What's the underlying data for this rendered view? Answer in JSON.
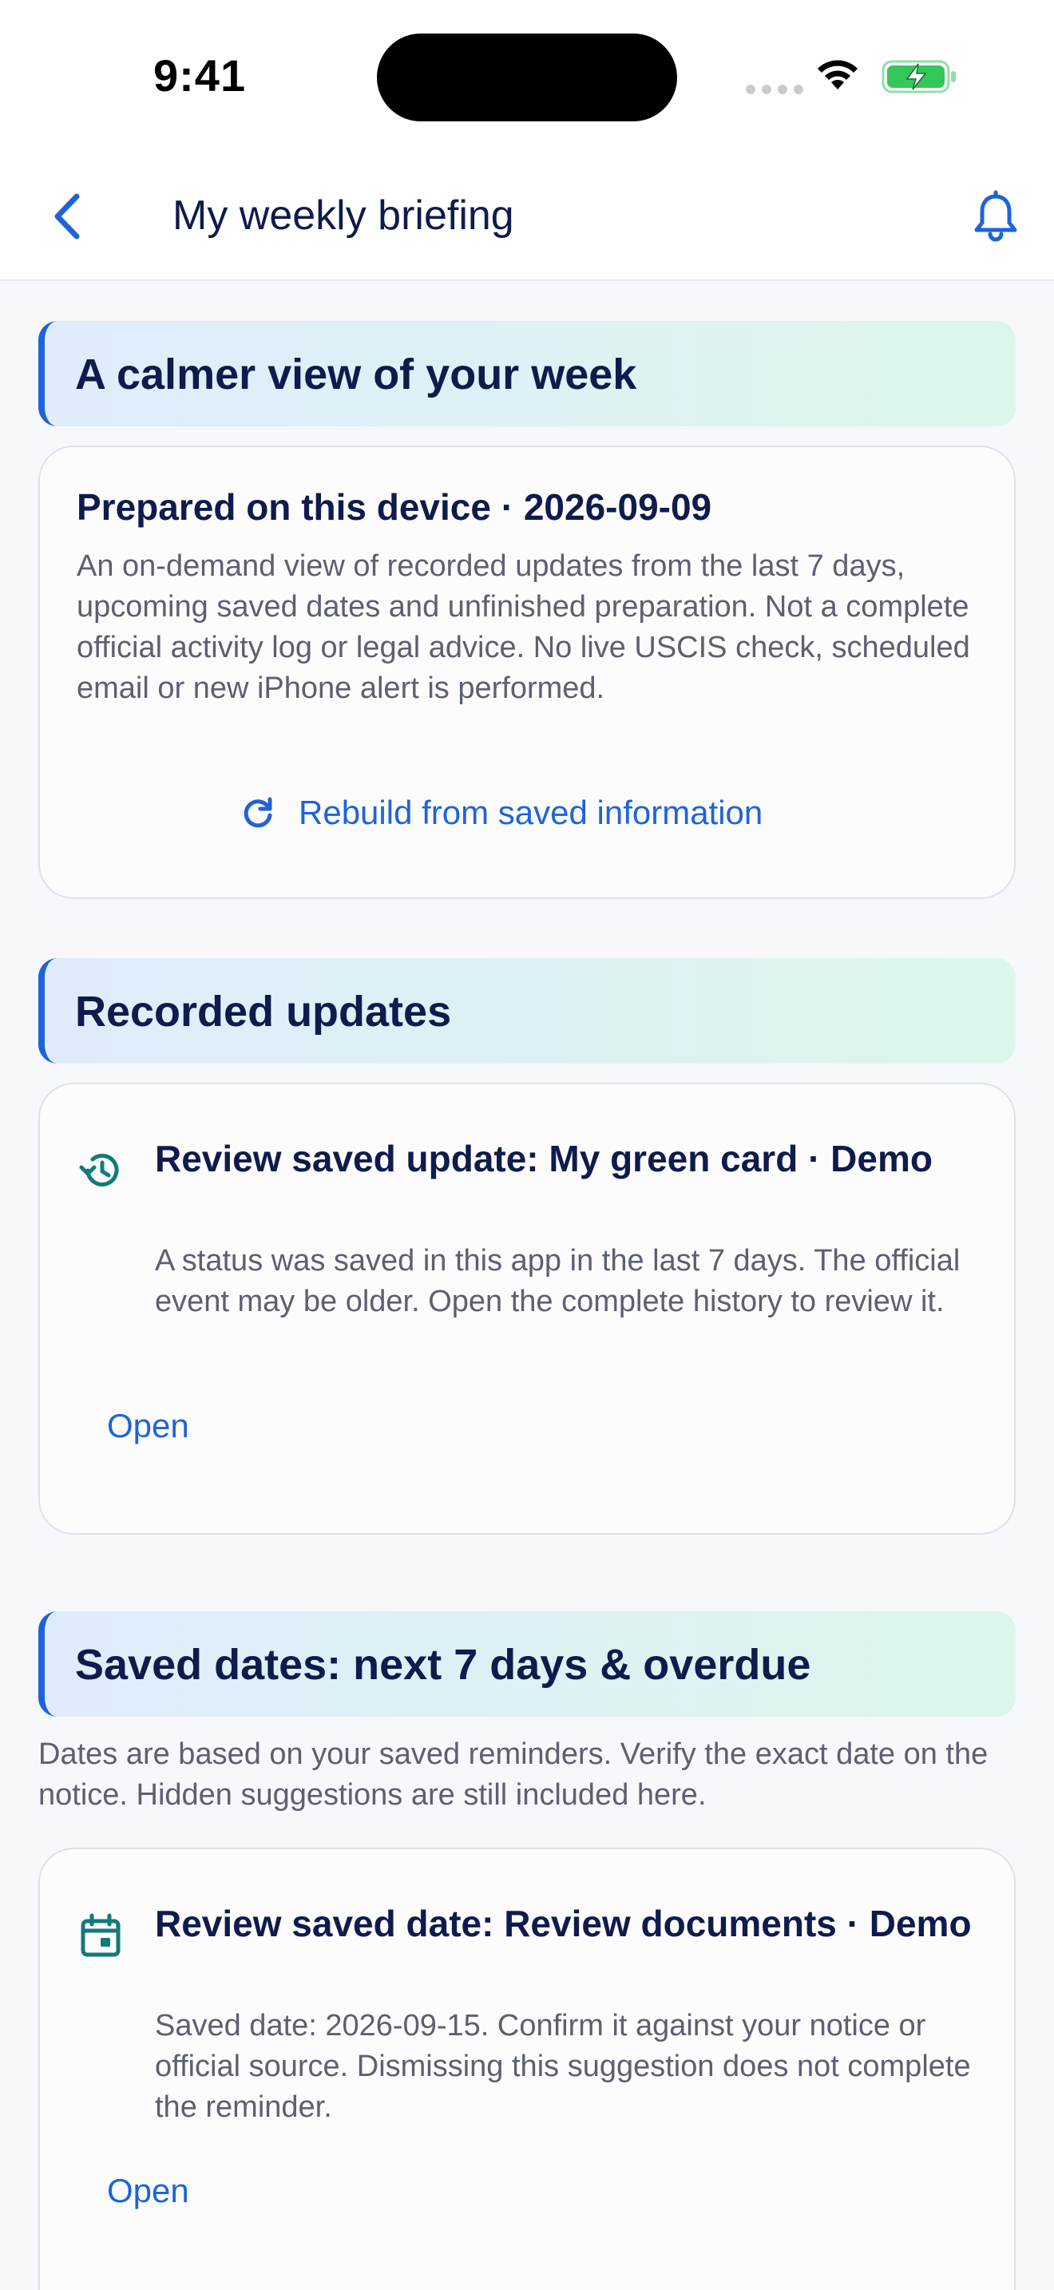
{
  "status_bar": {
    "time": "9:41"
  },
  "nav": {
    "title": "My weekly briefing",
    "back_icon": "chevron-left-icon",
    "bell_icon": "bell-icon"
  },
  "colors": {
    "accent": "#1f63d9",
    "title_text": "#0f1b4c",
    "body_text": "#5c6070",
    "icon_teal": "#127a7a"
  },
  "calm_section": {
    "header": "A calmer view of your week",
    "card": {
      "title": "Prepared on this device · 2026-09-09",
      "body": "An on-demand view of recorded updates from the last 7 days, upcoming saved dates and unfinished preparation. Not a complete official activity log or legal advice. No live USCIS check, scheduled email or new iPhone alert is performed.",
      "action_label": "Rebuild from saved information",
      "action_icon": "refresh-icon"
    }
  },
  "recorded_section": {
    "header": "Recorded updates",
    "item": {
      "icon": "history-icon",
      "title": "Review saved update: My green card · Demo",
      "body": "A status was saved in this app in the last 7 days. The official event may be older. Open the complete history to review it.",
      "action_label": "Open"
    }
  },
  "dates_section": {
    "header": "Saved dates: next 7 days & overdue",
    "note": "Dates are based on your saved reminders. Verify the exact date on the notice. Hidden suggestions are still included here.",
    "item": {
      "icon": "calendar-icon",
      "title": "Review saved date: Review documents · Demo",
      "body": "Saved date: 2026-09-15. Confirm it against your notice or official source. Dismissing this suggestion does not complete the reminder.",
      "action_label": "Open"
    }
  }
}
